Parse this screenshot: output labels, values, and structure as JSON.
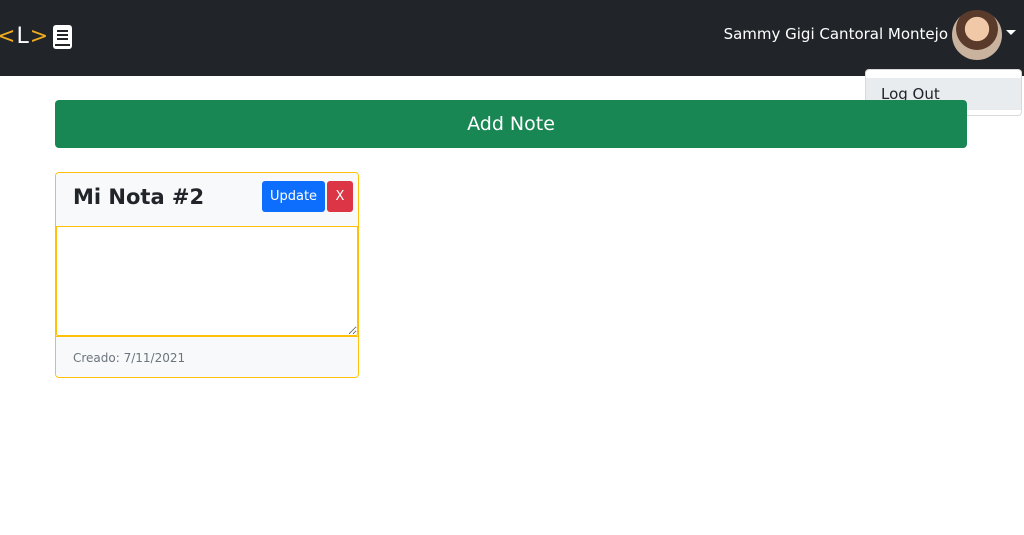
{
  "navbar": {
    "logo": {
      "lt": "<",
      "letter": "L",
      "gt": ">",
      "icon": "book-icon",
      "accent": "#f0ad1e"
    },
    "user_name": "Sammy Gigi Cantoral Montejo",
    "avatar": "user-avatar",
    "caret_icon": "caret-down-icon",
    "background": "#212529"
  },
  "dropdown": {
    "items": [
      {
        "label": "Log Out"
      }
    ]
  },
  "actions": {
    "add_note_label": "Add Note",
    "color": "#198754"
  },
  "notes": [
    {
      "title": "Mi Nota #2",
      "content": "",
      "update_label": "Update",
      "delete_label": "X",
      "created": "Creado: 7/11/2021",
      "border_color": "#ffc107"
    }
  ]
}
